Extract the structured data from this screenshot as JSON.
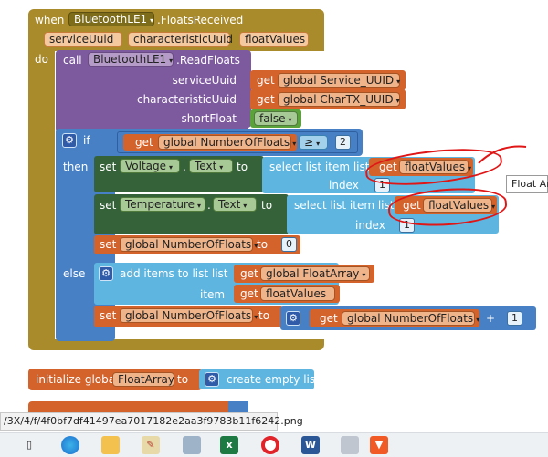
{
  "event": {
    "when": "when",
    "component": "BluetoothLE1",
    "event_name": ".FloatsReceived",
    "params": [
      "serviceUuid",
      "characteristicUuid",
      "floatValues"
    ],
    "do": "do"
  },
  "call_block": {
    "call": "call",
    "component": "BluetoothLE1",
    "method": ".ReadFloats",
    "args": [
      {
        "name": "serviceUuid",
        "get": "get",
        "value": "global Service_UUID"
      },
      {
        "name": "characteristicUuid",
        "get": "get",
        "value": "global CharTX_UUID"
      },
      {
        "name": "shortFloat",
        "value": "false"
      }
    ]
  },
  "if_block": {
    "if": "if",
    "then": "then",
    "else": "else",
    "condition": {
      "get": "get",
      "var": "global NumberOfFloats",
      "op": "≥",
      "value": "2"
    }
  },
  "then_blocks": {
    "set1": {
      "set": "set",
      "component": "Voltage",
      "prop": "Text",
      "to": "to",
      "select": "select list item  list",
      "get": "get",
      "var": "floatValues",
      "index_label": "index",
      "index": "1"
    },
    "set2": {
      "set": "set",
      "component": "Temperature",
      "prop": "Text",
      "to": "to",
      "select": "select list item  list",
      "get": "get",
      "var": "floatValues",
      "index_label": "index",
      "index": "1"
    },
    "set3": {
      "set": "set",
      "var": "global NumberOfFloats",
      "to": "to",
      "value": "0"
    }
  },
  "else_blocks": {
    "add": {
      "label": "add items to list   list",
      "get": "get",
      "list": "global FloatArray",
      "item_label": "item",
      "item": "floatValues"
    },
    "set": {
      "set": "set",
      "var": "global NumberOfFloats",
      "to": "to",
      "get": "get",
      "val_var": "global NumberOfFloats",
      "op": "+",
      "value": "1"
    }
  },
  "init_block": {
    "label": "initialize global",
    "var": "FloatArray",
    "to": "to",
    "value": "create empty list"
  },
  "tooltip": "Float Ar",
  "url": "/3X/4/f/4f0bf7df41497ea7017182e2aa3f9783b11f6242.png",
  "colors": {
    "event": "#a98b2b",
    "procedure": "#7d5a9e",
    "control": "#4780c4",
    "text": "#36623a",
    "variable": "#d4622b",
    "list": "#5eb6e0",
    "annotation": "#e01616"
  }
}
